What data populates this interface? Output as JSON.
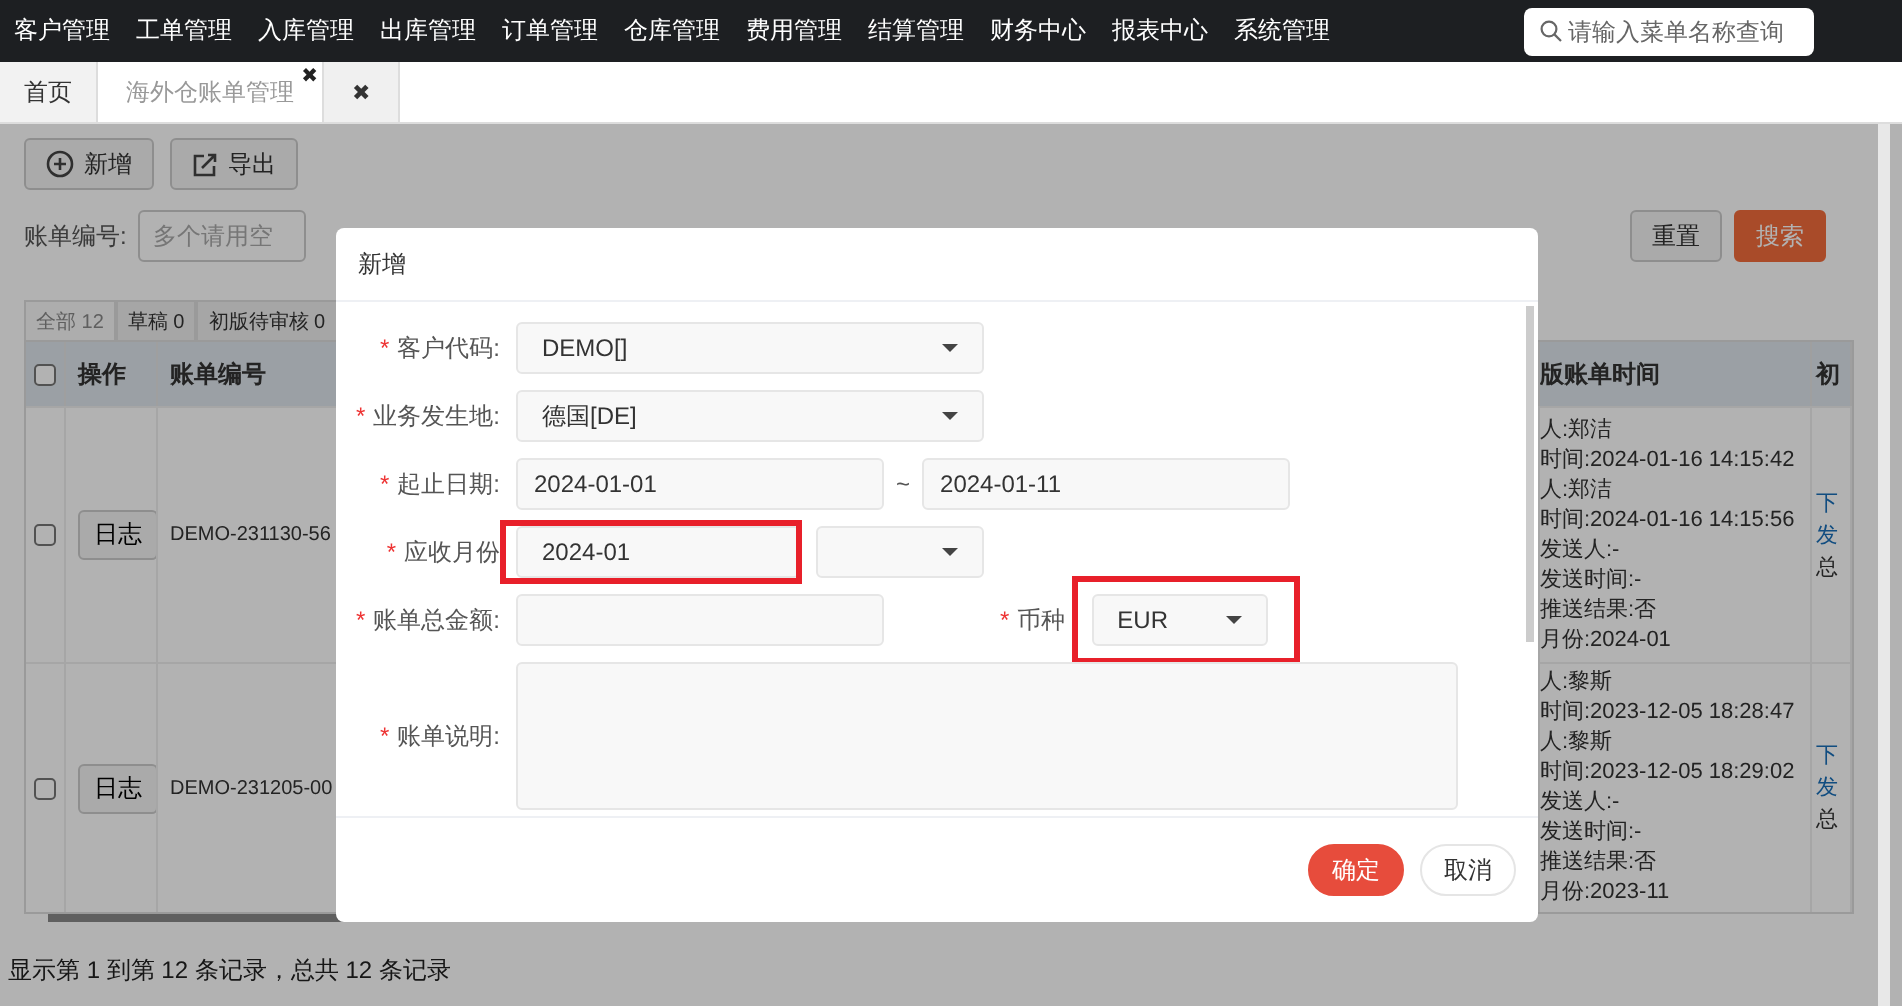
{
  "menu": [
    {
      "label": "客户管理"
    },
    {
      "label": "工单管理"
    },
    {
      "label": "入库管理"
    },
    {
      "label": "出库管理"
    },
    {
      "label": "订单管理"
    },
    {
      "label": "仓库管理"
    },
    {
      "label": "费用管理"
    },
    {
      "label": "结算管理"
    },
    {
      "label": "财务中心"
    },
    {
      "label": "报表中心"
    },
    {
      "label": "系统管理"
    }
  ],
  "search": {
    "placeholder": "请输入菜单名称查询"
  },
  "tabs": [
    {
      "label": "首页",
      "selected": false
    },
    {
      "label": "海外仓账单管理",
      "selected": true,
      "close": "✖"
    }
  ],
  "tab_close_all": "✖",
  "toolbar": [
    {
      "label": "新增"
    },
    {
      "label": "导出"
    }
  ],
  "filter": {
    "label": "账单编号:",
    "placeholder": "多个请用空"
  },
  "actions": [
    {
      "label": "重置",
      "kind": "default"
    },
    {
      "label": "搜索",
      "kind": "primary"
    }
  ],
  "status_tabs": [
    {
      "label": "全部 12",
      "selected": true
    },
    {
      "label": "草稿 0",
      "selected": false
    },
    {
      "label": "初版待审核 0",
      "selected": false
    }
  ],
  "table": {
    "header_checked": false,
    "columns": [
      "操作",
      "账单编号",
      "版账单时间",
      "初"
    ],
    "rows": [
      {
        "checked": false,
        "action": "日志",
        "bill_no": "DEMO-231130-56",
        "time_lines": [
          "人:郑洁",
          "时间:2024-01-16 14:15:42",
          "人:郑洁",
          "时间:2024-01-16 14:15:56",
          "发送人:-",
          "发送时间:-",
          "推送结果:否",
          "月份:2024-01"
        ],
        "links": [
          "下",
          "发"
        ],
        "note": "总"
      },
      {
        "checked": false,
        "action": "日志",
        "bill_no": "DEMO-231205-00",
        "time_lines": [
          "人:黎斯",
          "时间:2023-12-05 18:28:47",
          "人:黎斯",
          "时间:2023-12-05 18:29:02",
          "发送人:-",
          "发送时间:-",
          "推送结果:否",
          "月份:2023-11"
        ],
        "links": [
          "下",
          "发"
        ],
        "note": "总"
      }
    ]
  },
  "pagination": "显示第 1 到第 12 条记录，总共 12 条记录",
  "dialog": {
    "title": "新增",
    "fields": [
      {
        "kind": "select",
        "mark": "*",
        "label": "客户代码:",
        "value": "DEMO[]"
      },
      {
        "kind": "select",
        "mark": "*",
        "label": "业务发生地:",
        "value": "德国[DE]"
      },
      {
        "kind": "range",
        "mark": "*",
        "label": "起止日期:",
        "from": "2024-01-01",
        "separator": "~",
        "to": "2024-01-11"
      },
      {
        "kind": "month",
        "mark": "*",
        "label": "应收月份",
        "value": "2024-01",
        "highlighted": true
      },
      {
        "kind": "amount",
        "mark": "*",
        "label": "账单总金额:",
        "side_mark": "*",
        "side_label": "币种",
        "side_value": "EUR",
        "side_highlighted": true
      },
      {
        "kind": "textarea",
        "mark": "*",
        "label": "账单说明:"
      }
    ],
    "buttons": [
      {
        "label": "确定",
        "kind": "primary"
      },
      {
        "label": "取消",
        "kind": "default"
      }
    ]
  }
}
